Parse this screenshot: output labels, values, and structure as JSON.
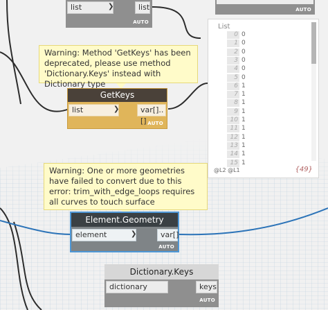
{
  "top_left_node": {
    "in_port": "list",
    "out_port": "list",
    "footer": "AUTO"
  },
  "top_right_node": {
    "footer": "AUTO"
  },
  "getkeys_warning": {
    "text": "Warning: Method 'GetKeys' has been deprecated, please use method 'Dictionary.Keys' instead with Dictionary type"
  },
  "getkeys_node": {
    "title": "GetKeys",
    "in_port": "list",
    "out_port": "var[]..[]",
    "footer": "AUTO",
    "header_color": "#4a4139",
    "body_color": "#e0b55a"
  },
  "watch_panel": {
    "title": "List",
    "rows": [
      {
        "index": "0",
        "value": "0"
      },
      {
        "index": "1",
        "value": "0"
      },
      {
        "index": "2",
        "value": "0"
      },
      {
        "index": "3",
        "value": "0"
      },
      {
        "index": "4",
        "value": "0"
      },
      {
        "index": "5",
        "value": "0"
      },
      {
        "index": "6",
        "value": "1"
      },
      {
        "index": "7",
        "value": "1"
      },
      {
        "index": "8",
        "value": "1"
      },
      {
        "index": "9",
        "value": "1"
      },
      {
        "index": "10",
        "value": "1"
      },
      {
        "index": "11",
        "value": "1"
      },
      {
        "index": "12",
        "value": "1"
      },
      {
        "index": "13",
        "value": "1"
      },
      {
        "index": "14",
        "value": "1"
      },
      {
        "index": "15",
        "value": "1"
      }
    ],
    "levels": "@L2 @L1",
    "count": "{49}"
  },
  "geometry_warning": {
    "text": "Warning: One or more geometries have failed to convert due to this error: trim_with_edge_loops requires all curves to touch surface"
  },
  "element_geometry_node": {
    "title": "Element.Geometry",
    "in_port": "element",
    "out_port": "var[]",
    "footer": "AUTO",
    "header_color": "#3a4044",
    "body_color": "#7f8487",
    "accent_color": "#4e97d6"
  },
  "dictionary_keys_node": {
    "title": "Dictionary.Keys",
    "in_port": "dictionary",
    "out_port": "keys",
    "footer": "AUTO"
  },
  "colors": {
    "wire_blue": "#2b73b8",
    "wire_dark": "#2c2c2c",
    "grid": "#a9c2d6",
    "warning_bg": "#fffbc9"
  }
}
